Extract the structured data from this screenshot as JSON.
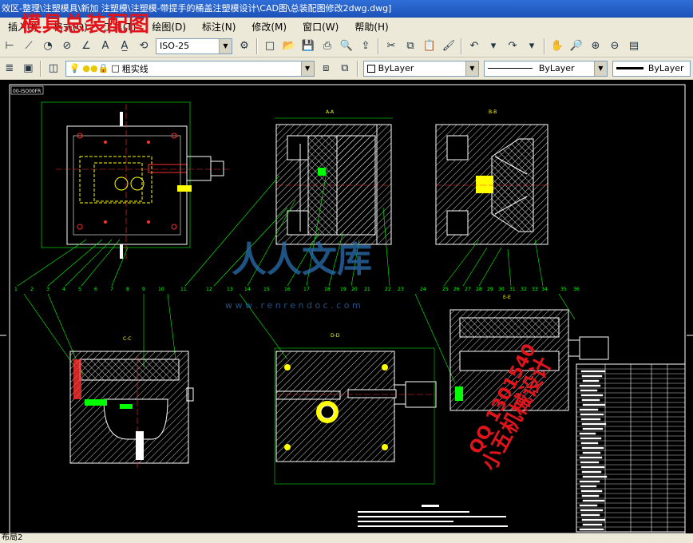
{
  "window": {
    "title": "效区-整理\\注塑模具\\新加 注塑模\\注塑模-带提手的桶盖注塑模设计\\CAD图\\总装配图修改2dwg.dwg]"
  },
  "watermark": {
    "top_text": "模具总装配图",
    "logo_text": "人人文库",
    "url_text": "w w w . r e n r e n d o c . c o m",
    "qq_text": "QQ 1301540",
    "name_text": "小五机械设计"
  },
  "menu": {
    "items": [
      "插入(I)",
      "格式(O)",
      "工具(T)",
      "绘图(D)",
      "标注(N)",
      "修改(M)",
      "窗口(W)",
      "帮助(H)"
    ]
  },
  "toolbar1": {
    "dimstyle_value": "ISO-25"
  },
  "toolbar2": {
    "layer_value": "粗实线",
    "color_value": "ByLayer",
    "linetype_value": "ByLayer",
    "lineweight_value": "ByLayer"
  },
  "drawing": {
    "view_label_aa": "A-A",
    "view_label_bb": "B-B",
    "view_label_cc": "C-C",
    "view_label_dd": "D-D",
    "view_label_ee": "E-E",
    "corner_label": "00-ISO00FR",
    "callouts": [
      "1",
      "2",
      "3",
      "4",
      "5",
      "6",
      "7",
      "8",
      "9",
      "10",
      "11",
      "12",
      "13",
      "14",
      "15",
      "16",
      "17",
      "18",
      "19",
      "20",
      "21",
      "22",
      "23",
      "24",
      "25",
      "26",
      "27",
      "28",
      "29",
      "30",
      "31",
      "32",
      "33",
      "34",
      "35",
      "36"
    ]
  },
  "status": {
    "layout_tab": "布局2"
  },
  "colors": {
    "accent_red": "#e0141a",
    "watermark_blue": "#2a6fb0",
    "cad_green": "#00ff00",
    "cad_yellow": "#ffff00",
    "cad_white": "#ffffff"
  }
}
